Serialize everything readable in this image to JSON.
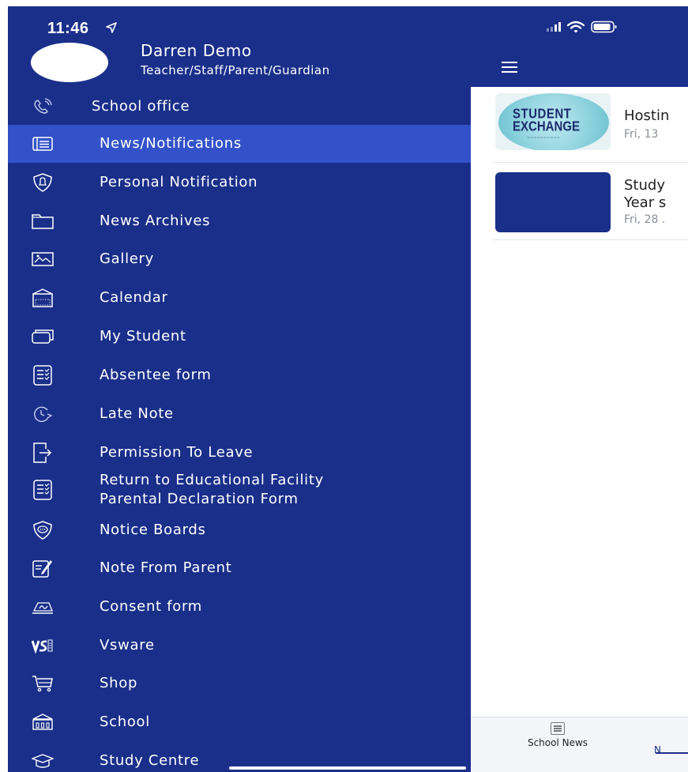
{
  "status_bar": {
    "time": "11:46"
  },
  "user": {
    "name": "Darren Demo",
    "role": "Teacher/Staff/Parent/Guardian"
  },
  "menu": [
    {
      "label": "School office",
      "icon": "phone-icon"
    },
    {
      "label": "News/Notifications",
      "icon": "newspaper-icon",
      "active": true
    },
    {
      "label": "Personal Notification",
      "icon": "bell-shield-icon"
    },
    {
      "label": "News Archives",
      "icon": "folder-icon"
    },
    {
      "label": "Gallery",
      "icon": "image-icon"
    },
    {
      "label": "Calendar",
      "icon": "calendar-icon"
    },
    {
      "label": "My Student",
      "icon": "card-icon"
    },
    {
      "label": "Absentee form",
      "icon": "checklist-icon"
    },
    {
      "label": "Late Note",
      "icon": "clock-icon"
    },
    {
      "label": "Permission To Leave",
      "icon": "exit-icon"
    },
    {
      "label": "Return to Educational Facility\nParental Declaration Form",
      "icon": "checklist-icon"
    },
    {
      "label": "Notice Boards",
      "icon": "chat-shield-icon"
    },
    {
      "label": "Note From Parent",
      "icon": "note-edit-icon"
    },
    {
      "label": "Consent form",
      "icon": "signature-icon"
    },
    {
      "label": "Vsware",
      "icon": "vsware-logo-icon"
    },
    {
      "label": "Shop",
      "icon": "cart-icon"
    },
    {
      "label": "School",
      "icon": "school-building-icon"
    },
    {
      "label": "Study Centre",
      "icon": "graduation-cap-icon"
    }
  ],
  "news": [
    {
      "title": "Hostin",
      "date": "Fri, 13",
      "thumb_text": [
        "STUDENT",
        "EXCHANGE"
      ]
    },
    {
      "title_line1": "Study",
      "title_line2": "Year s",
      "date": "Fri, 28 ."
    }
  ],
  "tabs": {
    "school_news": "School News",
    "next_tab": "N"
  },
  "colors": {
    "drawer": "#1a2f8a",
    "active": "#3352c9",
    "text": "#ffffff"
  }
}
